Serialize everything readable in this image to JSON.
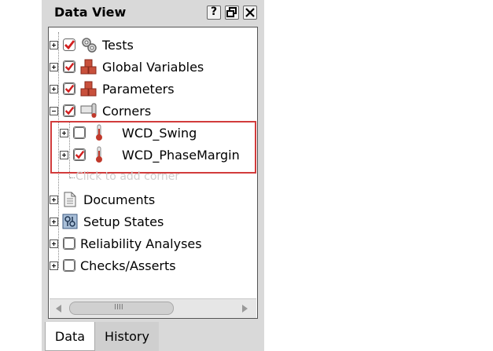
{
  "panel": {
    "title": "Data View",
    "header_buttons": [
      "help",
      "float",
      "close"
    ]
  },
  "tree": {
    "items": [
      {
        "label": "Tests",
        "expander": "plus",
        "checked": true,
        "icon": "gears-icon"
      },
      {
        "label": "Global Variables",
        "expander": "plus",
        "checked": true,
        "icon": "cubes-icon"
      },
      {
        "label": "Parameters",
        "expander": "plus",
        "checked": true,
        "icon": "cubes-icon"
      },
      {
        "label": "Corners",
        "expander": "minus",
        "checked": true,
        "icon": "corners-icon"
      },
      {
        "label": "WCD_Swing",
        "expander": "plus",
        "checked": false,
        "icon": "thermometer-icon"
      },
      {
        "label": "WCD_PhaseMargin",
        "expander": "plus",
        "checked": true,
        "icon": "thermometer-icon"
      },
      {
        "label": "Documents",
        "expander": "plus",
        "icon": "document-icon"
      },
      {
        "label": "Setup States",
        "expander": "plus",
        "icon": "setup-states-icon"
      },
      {
        "label": "Reliability Analyses",
        "expander": "plus",
        "checked": false
      },
      {
        "label": "Checks/Asserts",
        "expander": "plus",
        "checked": false
      }
    ],
    "add_corner_placeholder": "Click to add corner"
  },
  "scrollbar": {
    "thumb_label": "IIII"
  },
  "tabs": [
    {
      "label": "Data",
      "active": true
    },
    {
      "label": "History",
      "active": false
    }
  ],
  "colors": {
    "highlight_box": "#d23c3c",
    "check_mark": "#d11f1f"
  }
}
